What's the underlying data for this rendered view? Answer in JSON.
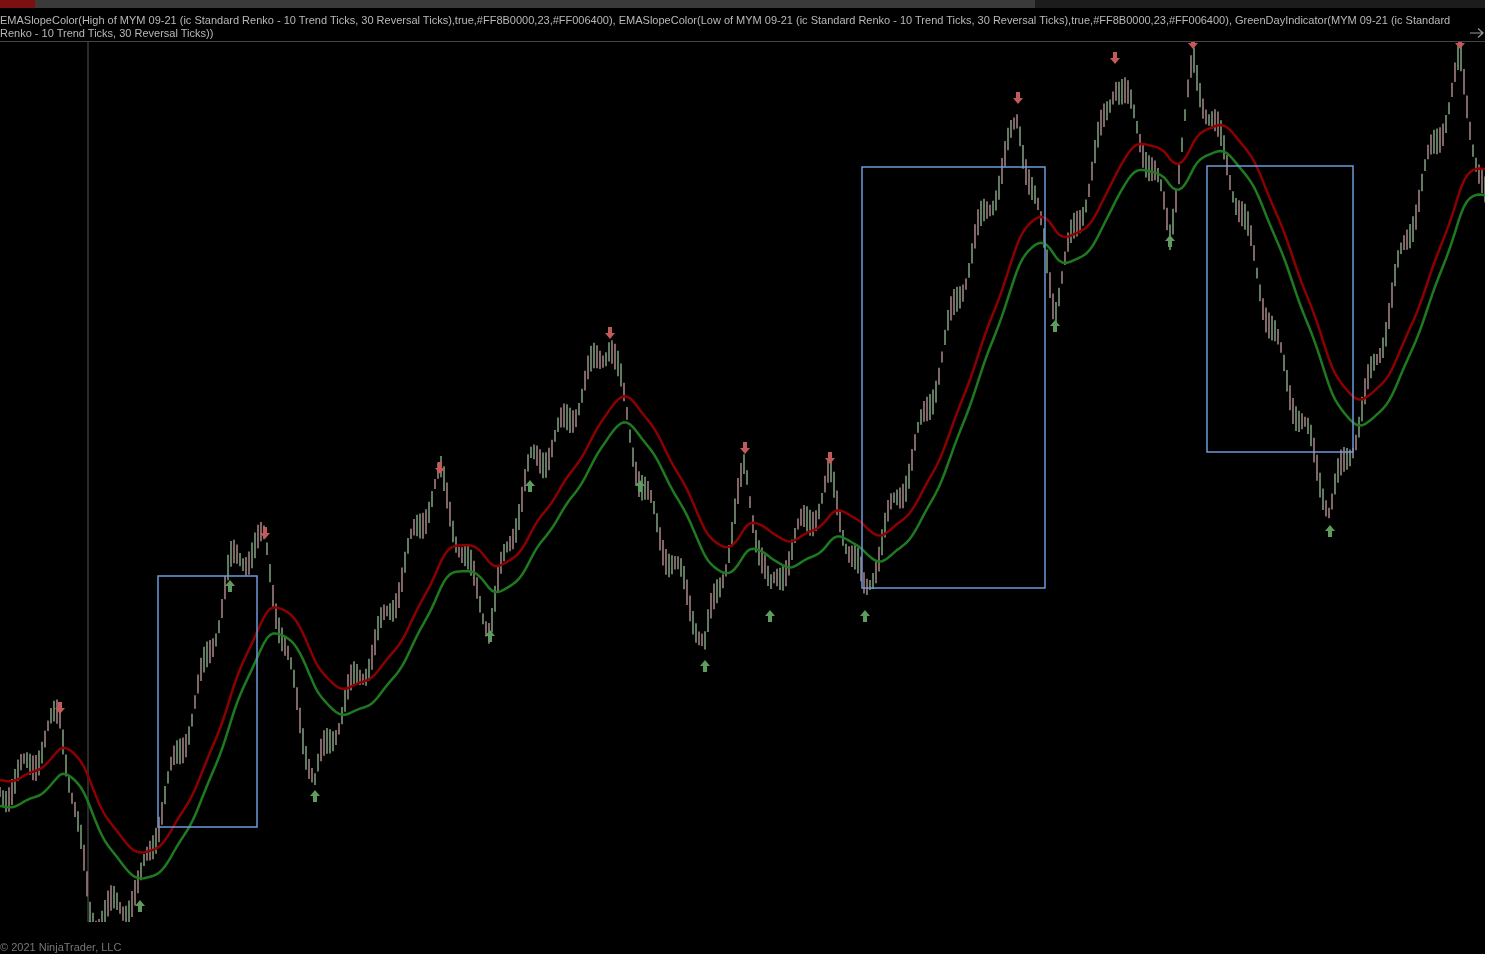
{
  "indicator_label": "EMASlopeColor(High of MYM 09-21 (ic Standard Renko - 10 Trend Ticks, 30 Reversal Ticks),true,#FF8B0000,23,#FF006400), EMASlopeColor(Low of MYM 09-21 (ic Standard Renko - 10 Trend Ticks, 30 Reversal Ticks),true,#FF8B0000,23,#FF006400), GreenDayIndicator(MYM 09-21 (ic Standard Renko - 10 Trend Ticks, 30 Reversal Ticks))",
  "copyright": "© 2021 NinjaTrader, LLC"
}
